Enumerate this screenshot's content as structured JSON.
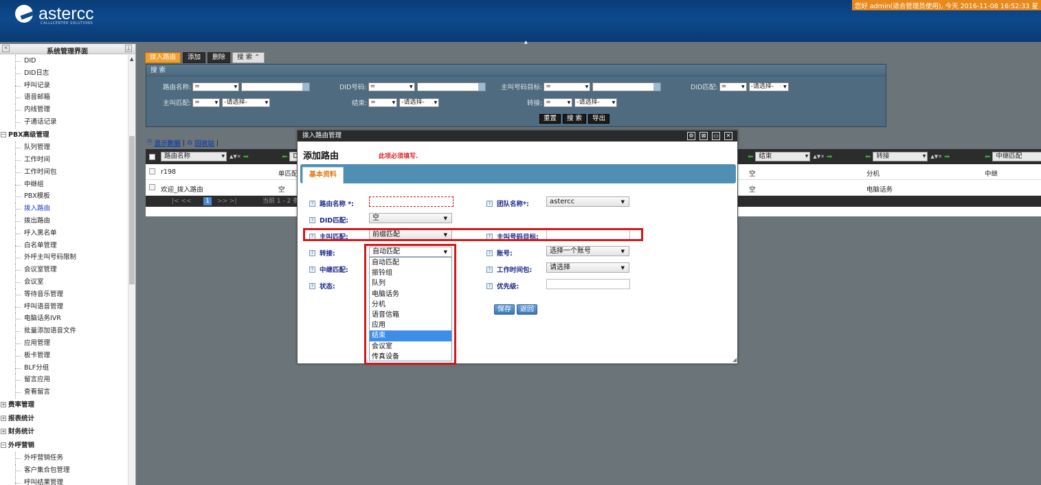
{
  "header": {
    "logo_text": "astercc",
    "logo_sub": "CALLLCENTER SOLUTIONS",
    "user_info": "您好 admin(适合管理员使用), 今天 2016-11-08 16:52:33 星"
  },
  "sidebar": {
    "title": "系统管理界面",
    "items_top": [
      "DID",
      "DID日志",
      "呼叫记录",
      "语音邮箱",
      "内线管理",
      "子通话记录"
    ],
    "group_pbx": "PBX高级管理",
    "items_pbx": [
      "队列管理",
      "工作时间",
      "工作时间包",
      "中继组",
      "PBX模板",
      "拨入路由",
      "拨出路由",
      "呼入黑名单",
      "白名单管理",
      "外呼主叫号码限制",
      "会议室管理",
      "会议室",
      "等待音乐管理",
      "呼叫语音管理",
      "电脑话务IVR",
      "批量添加语音文件",
      "应用管理",
      "板卡管理",
      "BLF分组",
      "留言应用",
      "查看留言"
    ],
    "active_item": "拨入路由",
    "groups_bottom": [
      "费率管理",
      "报表统计",
      "财务统计",
      "外呼营销"
    ],
    "items_marketing": [
      "外呼营销任务",
      "客户集合包管理",
      "呼叫结果管理"
    ]
  },
  "toolbar": {
    "tab_inbound": "拨入路由",
    "add": "添加",
    "delete": "删除",
    "search": "搜 索"
  },
  "search_panel": {
    "title": "搜 索",
    "route_name_label": "路由名称:",
    "did_number_label": "DID号码:",
    "caller_target_label": "主叫号码目标:",
    "did_match_label": "DID匹配:",
    "caller_match_label": "主叫匹配:",
    "end_label": "结束:",
    "transfer_label": "转接:",
    "op_eq": "=",
    "please_select": "-请选择-",
    "reset": "重置",
    "search_btn": "搜 索",
    "export": "导出"
  },
  "grid": {
    "show_data": "显示数据",
    "recycle": "回收站",
    "columns": [
      "路由名称",
      "DI",
      "结束",
      "转接",
      "中继匹配"
    ],
    "rows": [
      {
        "name": "r198",
        "did": "单匹配",
        "end": "空",
        "transfer": "分机",
        "trunk": "中继"
      },
      {
        "name": "欢迎_拨入路由",
        "did": "空",
        "end": "空",
        "transfer": "电脑话务",
        "trunk": ""
      }
    ],
    "pager_prev": "|<   <<",
    "pager_page": "1",
    "pager_next": ">>   >|",
    "pager_info": "当前 1 - 2 条"
  },
  "dialog": {
    "title": "拨入路由管理",
    "heading": "添加路由",
    "required_note": "此项必须填写.",
    "tab_basic": "基本资料",
    "fields": {
      "route_name": "路由名称 *:",
      "team_name": "团队名称*:",
      "team_value": "astercc",
      "did_match": "DID匹配:",
      "did_match_value": "空",
      "caller_match": "主叫匹配:",
      "caller_match_value": "前缀匹配",
      "caller_target": "主叫号码目标:",
      "transfer": "转接:",
      "transfer_value": "自动匹配",
      "account": "账号:",
      "account_value": "选择一个账号",
      "trunk_match": "中继匹配:",
      "work_time_pkg": "工作时间包:",
      "work_time_value": "请选择",
      "status": "状态:",
      "priority": "优先级:"
    },
    "dropdown_options": [
      "自动匹配",
      "振铃组",
      "队列",
      "电脑话务",
      "分机",
      "语音信箱",
      "应用",
      "结束",
      "会议室",
      "传真设备"
    ],
    "dropdown_selected": "结束",
    "save": "保存",
    "back": "返回"
  }
}
